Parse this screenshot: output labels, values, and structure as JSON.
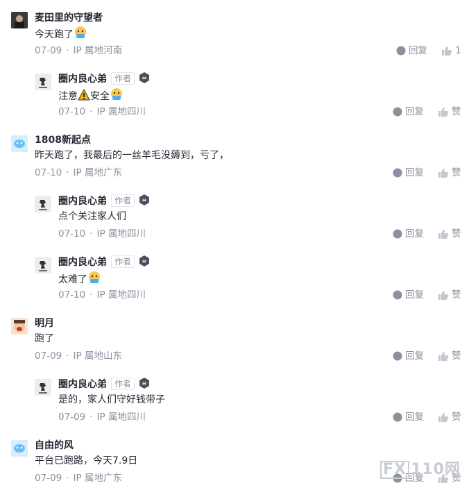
{
  "comments": [
    {
      "name": "麦田里的守望者",
      "text": "今天跑了",
      "date": "07-09",
      "ip": "IP 属地河南",
      "reply": "回复",
      "like": "1",
      "is_author": false,
      "has_emoji": true
    },
    {
      "name": "圈内良心弟",
      "text": "注意",
      "text2": "安全",
      "date": "07-10",
      "ip": "IP 属地四川",
      "reply": "回复",
      "like": "赞",
      "is_author": true,
      "author_tag": "作者"
    },
    {
      "name": "1808新起点",
      "text": "昨天跑了，我最后的一丝羊毛没薅到，亏了，",
      "date": "07-10",
      "ip": "IP 属地广东",
      "reply": "回复",
      "like": "赞",
      "is_author": false
    },
    {
      "name": "圈内良心弟",
      "text": "点个关注家人们",
      "date": "07-10",
      "ip": "IP 属地四川",
      "reply": "回复",
      "like": "赞",
      "is_author": true,
      "author_tag": "作者"
    },
    {
      "name": "圈内良心弟",
      "text": "太难了",
      "date": "07-10",
      "ip": "IP 属地四川",
      "reply": "回复",
      "like": "赞",
      "is_author": true,
      "author_tag": "作者"
    },
    {
      "name": "明月",
      "text": "跑了",
      "date": "07-09",
      "ip": "IP 属地山东",
      "reply": "回复",
      "like": "赞",
      "is_author": false
    },
    {
      "name": "圈内良心弟",
      "text": "是的，家人们守好钱带子",
      "date": "07-09",
      "ip": "IP 属地四川",
      "reply": "回复",
      "like": "赞",
      "is_author": true,
      "author_tag": "作者"
    },
    {
      "name": "自由的风",
      "text": "平台已跑路，今天7.9日",
      "date": "07-09",
      "ip": "IP 属地广东",
      "reply": "回复",
      "like": "赞",
      "is_author": false
    }
  ],
  "watermark": {
    "box": "FX",
    "rest": "110网"
  },
  "colors": {
    "meta": "#8a919f",
    "text": "#252933",
    "name": "#252933"
  }
}
